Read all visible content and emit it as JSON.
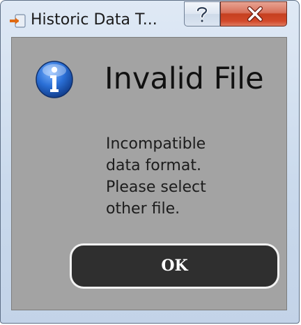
{
  "window": {
    "title": "Historic Data T...",
    "app_icon": "open-file-arrow-icon"
  },
  "titlebar_buttons": {
    "help": {
      "glyph": "?",
      "icon": "help-icon"
    },
    "close": {
      "glyph": "X",
      "icon": "close-icon"
    }
  },
  "dialog": {
    "icon": "info-icon",
    "heading": "Invalid File",
    "message": "Incompatible\ndata format.\nPlease select\nother file.",
    "ok_label": "OK"
  },
  "colors": {
    "client_background": "#a3a3a3",
    "ok_button": "#2f2f2f",
    "close_button": "#c5401f",
    "info_icon_blue": "#1f5fbf"
  }
}
